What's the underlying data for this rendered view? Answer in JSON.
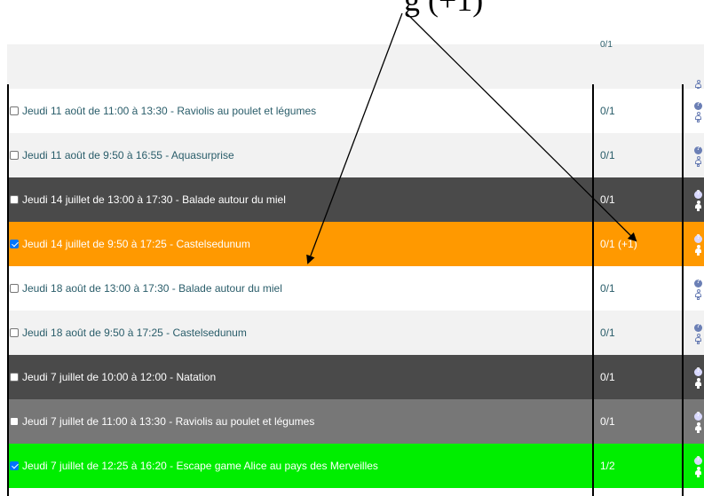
{
  "caption": "g  (+1)",
  "rows": [
    {
      "label": "",
      "count": "0/1",
      "checked": false,
      "bg": "#f2f2f2",
      "text_color": "#2a5d6a",
      "count_color": "#2a5d6a"
    },
    {
      "label": "Jeudi 11 août de 11:00 à 13:30 - Raviolis au poulet et légumes",
      "count": "0/1",
      "checked": false,
      "bg": "#ffffff",
      "text_color": "#2a5d6a",
      "count_color": "#2a5d6a"
    },
    {
      "label": "Jeudi 11 août de 9:50 à 16:55 - Aquasurprise",
      "count": "0/1",
      "checked": false,
      "bg": "#f2f2f2",
      "text_color": "#2a5d6a",
      "count_color": "#2a5d6a"
    },
    {
      "label": "Jeudi 14 juillet de 13:00 à 17:30 - Balade autour du miel",
      "count": "0/1",
      "checked": false,
      "bg": "#4a4a4a",
      "text_color": "#ffffff",
      "count_color": "#ffffff"
    },
    {
      "label": "Jeudi 14 juillet de 9:50 à 17:25 - Castelsedunum",
      "count": "0/1 (+1)",
      "checked": true,
      "bg": "#ff9900",
      "text_color": "#ffffff",
      "count_color": "#ffffff"
    },
    {
      "label": "Jeudi 18 août de 13:00 à 17:30 - Balade autour du miel",
      "count": "0/1",
      "checked": false,
      "bg": "#ffffff",
      "text_color": "#2a5d6a",
      "count_color": "#2a5d6a"
    },
    {
      "label": "Jeudi 18 août de 9:50 à 17:25 - Castelsedunum",
      "count": "0/1",
      "checked": false,
      "bg": "#f2f2f2",
      "text_color": "#2a5d6a",
      "count_color": "#2a5d6a"
    },
    {
      "label": "Jeudi 7 juillet de 10:00 à 12:00 - Natation",
      "count": "0/1",
      "checked": false,
      "bg": "#4a4a4a",
      "text_color": "#ffffff",
      "count_color": "#ffffff"
    },
    {
      "label": "Jeudi 7 juillet de 11:00 à 13:30 - Raviolis au poulet et légumes",
      "count": "0/1",
      "checked": false,
      "bg": "#777777",
      "text_color": "#ffffff",
      "count_color": "#ffffff"
    },
    {
      "label": "Jeudi 7 juillet de 12:25 à 16:20 - Escape game Alice au pays des Merveilles",
      "count": "1/2",
      "checked": true,
      "bg": "#00ee00",
      "text_color": "#ffffff",
      "count_color": "#ffffff"
    }
  ],
  "icons": {
    "info": "info-icon",
    "person": "person-icon"
  }
}
